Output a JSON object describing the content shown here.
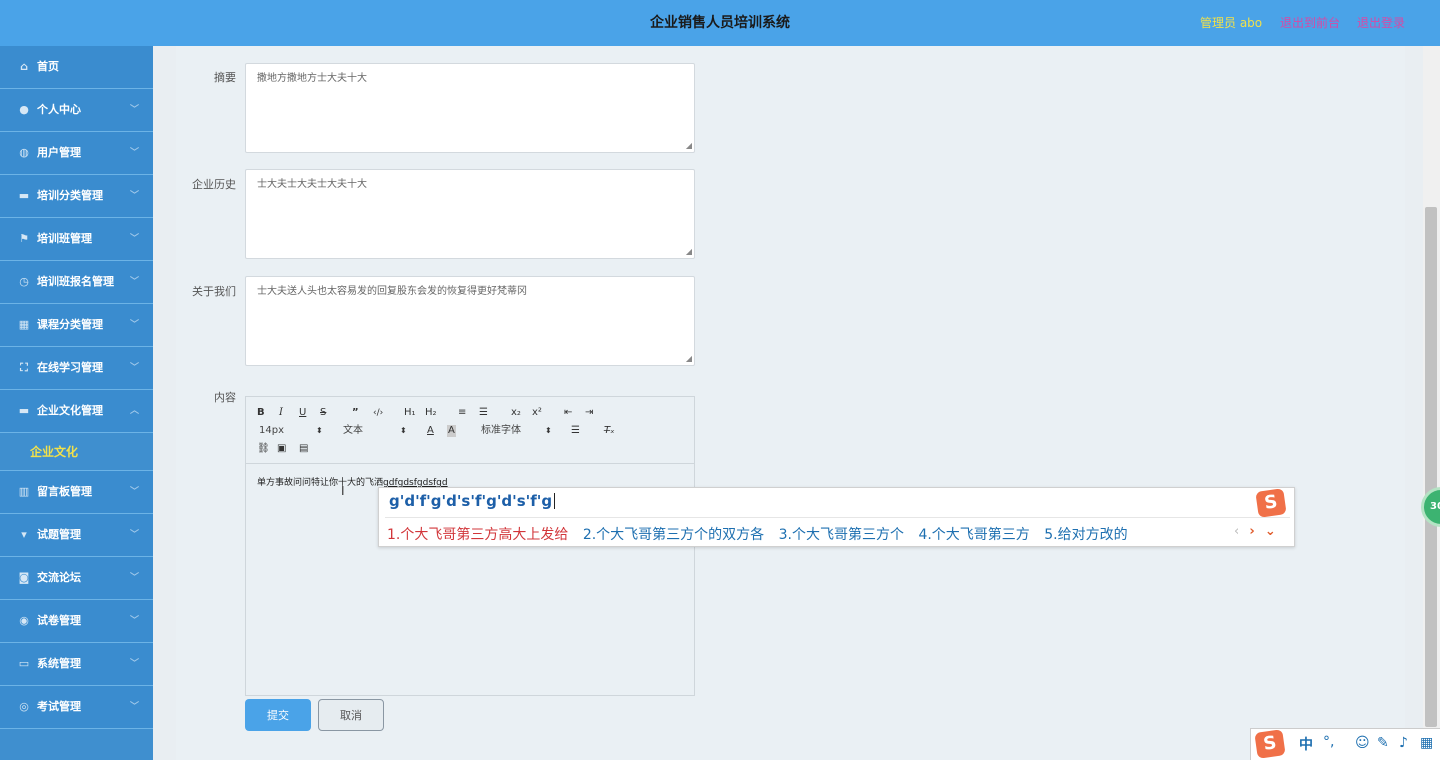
{
  "header": {
    "title": "企业销售人员培训系统",
    "admin": "管理员 abo",
    "to_front": "退出到前台",
    "logout": "退出登录"
  },
  "sidebar": {
    "items": [
      {
        "label": "首页",
        "icon": "home-icon"
      },
      {
        "label": "个人中心",
        "icon": "user-icon"
      },
      {
        "label": "用户管理",
        "icon": "mic-icon"
      },
      {
        "label": "培训分类管理",
        "icon": "briefcase-icon"
      },
      {
        "label": "培训班管理",
        "icon": "flag-icon"
      },
      {
        "label": "培训班报名管理",
        "icon": "clock-icon"
      },
      {
        "label": "课程分类管理",
        "icon": "grid-icon"
      },
      {
        "label": "在线学习管理",
        "icon": "frame-icon"
      },
      {
        "label": "企业文化管理",
        "icon": "briefcase-icon"
      },
      {
        "label": "留言板管理",
        "icon": "bar-chart-icon"
      },
      {
        "label": "试题管理",
        "icon": "cup-icon"
      },
      {
        "label": "交流论坛",
        "icon": "car-icon"
      },
      {
        "label": "试卷管理",
        "icon": "bulb-icon"
      },
      {
        "label": "系统管理",
        "icon": "monitor-icon"
      },
      {
        "label": "考试管理",
        "icon": "globe-icon"
      }
    ],
    "sub_item": "企业文化"
  },
  "form": {
    "summary_label": "摘要",
    "summary_value": "撒地方撒地方士大夫十大",
    "history_label": "企业历史",
    "history_value": "士大夫士大夫士大夫十大",
    "about_label": "关于我们",
    "about_value": "士大夫送人头也太容易发的回复股东会发的恢复得更好梵蒂冈",
    "content_label": "内容",
    "content_text": "单方事故问问特让你十大的飞洒",
    "content_underlined": "gdfgdsfgdsfgd",
    "submit": "提交",
    "cancel": "取消"
  },
  "editor": {
    "font_size": "14px",
    "font_type": "文本",
    "font_family": "标准字体"
  },
  "ime": {
    "composition": "g'd'f'g'd's'f'g'd's'f'g",
    "candidates": [
      "1.个大飞哥第三方高大上发给",
      "2.个大飞哥第三方个的双方各",
      "3.个大飞哥第三方个",
      "4.个大飞哥第三方",
      "5.给对方改的"
    ],
    "logo": "S"
  },
  "tray": {
    "lang": "中",
    "punct": "°,"
  },
  "float_ball": "30"
}
